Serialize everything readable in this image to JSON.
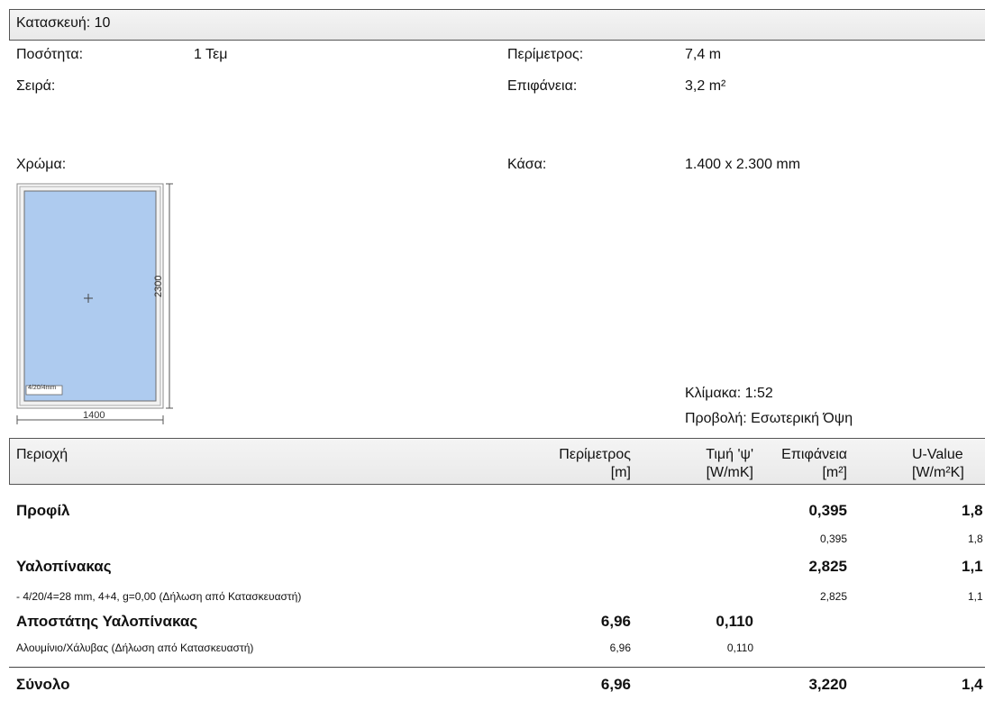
{
  "construction": {
    "title": "Κατασκευή: 10"
  },
  "info": {
    "quantity_label": "Ποσότητα:",
    "quantity_value": "1 Τεμ",
    "series_label": "Σειρά:",
    "color_label": "Χρώμα:",
    "perimeter_label": "Περίμετρος:",
    "perimeter_value": "7,4 m",
    "surface_label": "Επιφάνεια:",
    "surface_value": "3,2 m²",
    "frame_label": "Κάσα:",
    "frame_value": "1.400 x 2.300 mm"
  },
  "drawing": {
    "width_dim": "1400",
    "height_dim": "2300",
    "glass_tag": "4/20/4mm",
    "scale": "Κλίμακα: 1:52",
    "view": "Προβολή: Εσωτερική Όψη",
    "glass_color": "#aecbef"
  },
  "table": {
    "headers": {
      "area": "Περιοχή",
      "perimeter": "Περίμετρος",
      "perimeter_unit": "[m]",
      "psi": "Τιμή 'ψ'",
      "psi_unit": "[W/mK]",
      "surface": "Επιφάνεια",
      "surface_unit": "[m²]",
      "uvalue": "U-Value",
      "uvalue_unit": "[W/m²K]"
    },
    "rows": [
      {
        "name": "Προφίλ",
        "surface": "0,395",
        "uvalue": "1,8"
      },
      {
        "name": "",
        "surface": "0,395",
        "uvalue": "1,8"
      },
      {
        "name": "Υαλοπίνακας",
        "surface": "2,825",
        "uvalue": "1,1"
      },
      {
        "name": "- 4/20/4=28 mm, 4+4, g=0,00 (Δήλωση από Κατασκευαστή)",
        "surface": "2,825",
        "uvalue": "1,1"
      },
      {
        "name": "Αποστάτης Υαλοπίνακας",
        "perimeter": "6,96",
        "psi": "0,110"
      },
      {
        "name": "Αλουμίνιο/Χάλυβας (Δήλωση από Κατασκευαστή)",
        "perimeter": "6,96",
        "psi": "0,110"
      }
    ],
    "total": {
      "name": "Σύνολο",
      "perimeter": "6,96",
      "surface": "3,220",
      "uvalue": "1,4"
    }
  }
}
